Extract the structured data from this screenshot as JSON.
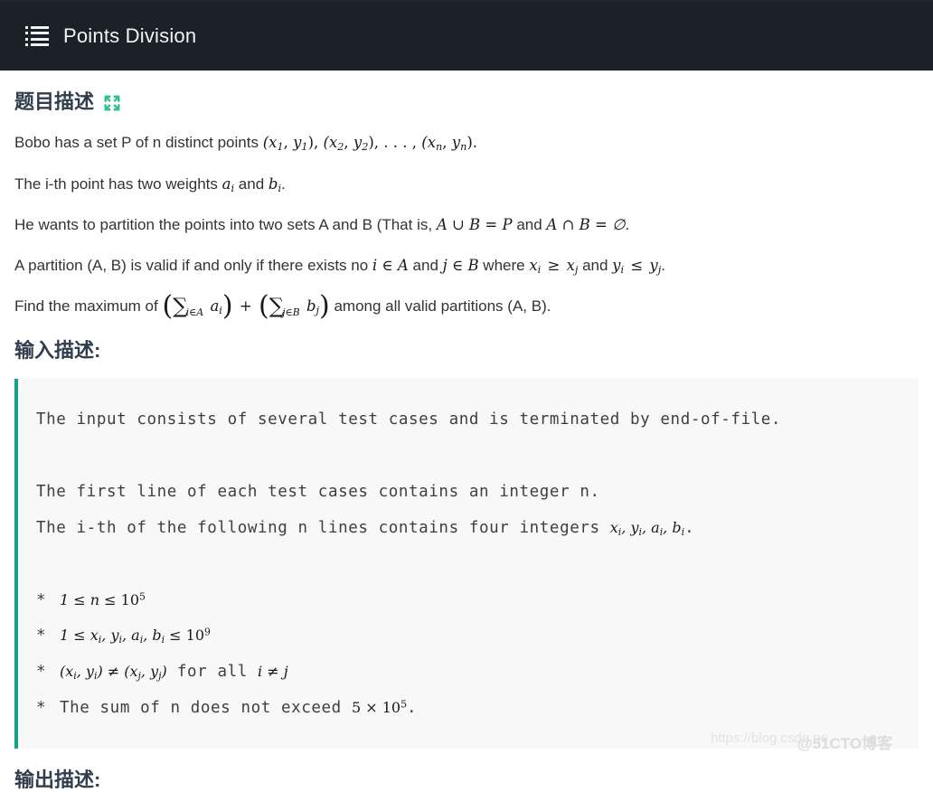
{
  "header": {
    "title": "Points Division",
    "menu_icon": "list-ul-icon",
    "background_color": "#1b2227",
    "text_color": "#f4f4f4"
  },
  "theme": {
    "accent_color": "#16a085",
    "heading_color": "#2f3d4c",
    "code_background": "#f8f8f8"
  },
  "sections": {
    "description": {
      "title": "题目描述",
      "expand_icon": "arrows-alt-expand-icon"
    },
    "input": {
      "title": "输入描述:"
    },
    "output": {
      "title": "输出描述:"
    }
  },
  "statement": {
    "line1": {
      "text_a": "Bobo has a set P of n distinct points ",
      "math": "(x₁, y₁), (x₂, y₂), …, (xₙ, yₙ).",
      "parts": {
        "open1": "(",
        "x1": "x",
        "x1sub": "1",
        "comma1": ", ",
        "y1": "y",
        "y1sub": "1",
        "close1": "), ",
        "open2": "(",
        "x2": "x",
        "x2sub": "2",
        "comma2": ", ",
        "y2": "y",
        "y2sub": "2",
        "close2": "), ",
        "dots": ". . . , ",
        "open3": "(",
        "xn": "x",
        "xnsub": "n",
        "comma3": ", ",
        "yn": "y",
        "ynsub": "n",
        "close3": ")."
      }
    },
    "line2": {
      "text_a": "The i-th point has two weights ",
      "a": "a",
      "asub": "i",
      "text_b": " and ",
      "b": "b",
      "bsub": "i",
      "text_c": "."
    },
    "line3": {
      "text_a": "He wants to partition the points into two sets A and B (That is, ",
      "math1": "A ∪ B = P",
      "text_b": " and ",
      "math2": "A ∩ B = ∅",
      "text_c": "."
    },
    "line4": {
      "text_a": "A partition (A, B) is valid if and only if there exists no ",
      "math1": "i ∈ A",
      "text_b": " and ",
      "math2": "j ∈ B",
      "text_c": " where ",
      "math3_x1": "x",
      "math3_x1sub": "i",
      "math3_op1": " ≥ ",
      "math3_x2": "x",
      "math3_x2sub": "j",
      "text_d": " and ",
      "math4_y1": "y",
      "math4_y1sub": "i",
      "math4_op": " ≤ ",
      "math4_y2": "y",
      "math4_y2sub": "j",
      "text_e": "."
    },
    "line5": {
      "text_a": "Find the maximum of ",
      "sum1_sub": "i∈A",
      "sum1_term": "a",
      "sum1_termsub": "i",
      "plus": " + ",
      "sum2_sub": "j∈B",
      "sum2_term": "b",
      "sum2_termsub": "j",
      "text_b": " among all valid partitions (A, B)."
    }
  },
  "input_code": {
    "line1": "The input consists of several test cases and is terminated by end-of-file.",
    "line2": "",
    "line3": "The first line of each test cases contains an integer n.",
    "line4_a": "The i-th of the following n lines contains four integers ",
    "line4_math": "xᵢ, yᵢ, aᵢ, bᵢ",
    "line4_b": ".",
    "line5": "",
    "bullets": [
      {
        "marker": "*",
        "math": "1 ≤ n ≤ 10⁵"
      },
      {
        "marker": "*",
        "math": "1 ≤ xᵢ, yᵢ, aᵢ, bᵢ ≤ 10⁹"
      },
      {
        "marker": "*",
        "math": "(xᵢ, yᵢ) ≠ (xⱼ, yⱼ)",
        "mono": " for all ",
        "math2": "i ≠ j"
      },
      {
        "marker": "*",
        "mono": "The sum of n does not exceed ",
        "math": "5 × 10⁵",
        "mono2": "."
      }
    ]
  },
  "watermark": {
    "url": "https://blog.csdn.ne",
    "tag": "@51CTO博客"
  }
}
